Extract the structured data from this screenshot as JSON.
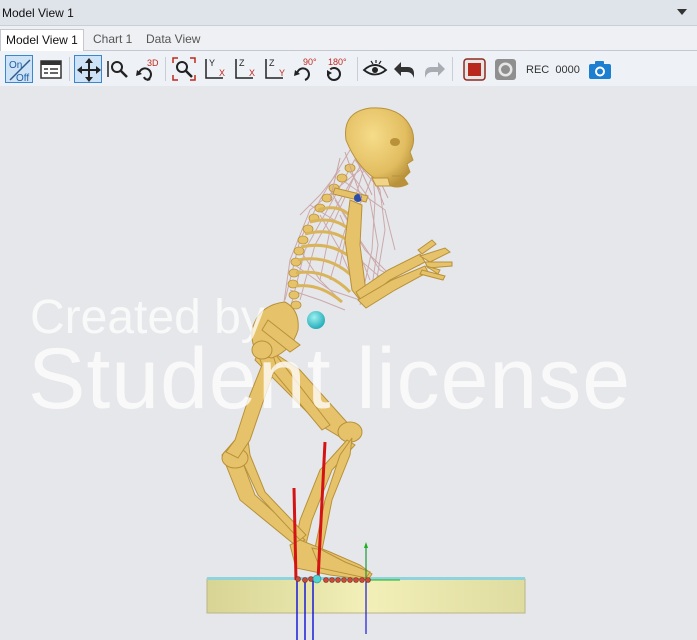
{
  "window": {
    "title": "Model View 1"
  },
  "tabs": [
    {
      "label": "Model View 1",
      "active": true
    },
    {
      "label": "Chart 1",
      "active": false
    },
    {
      "label": "Data View",
      "active": false
    }
  ],
  "toolbar": {
    "on_label": "On",
    "off_label": "Off",
    "label_3d": "3D",
    "axis_yx": [
      "Y",
      "X"
    ],
    "axis_zx": [
      "Z",
      "X"
    ],
    "axis_zy": [
      "Z",
      "Y"
    ],
    "rot_90": "90°",
    "rot_180": "180°",
    "rec_label": "REC",
    "rec_count": "0000",
    "icons": [
      "on-off-toggle-icon",
      "properties-icon",
      "pan-move-icon",
      "zoom-icon",
      "rotate-3d-icon",
      "zoom-fit-icon",
      "view-yx-icon",
      "view-zx-icon",
      "view-zy-icon",
      "rotate-90-icon",
      "rotate-180-icon",
      "visibility-eye-icon",
      "undo-icon",
      "redo-icon",
      "record-icon",
      "stop-icon",
      "camera-icon"
    ]
  },
  "viewport": {
    "watermark_line1": "Created by",
    "watermark_line2": "Student license"
  },
  "colors": {
    "bone": "#e6c36a",
    "bone_shadow": "#b8913a",
    "muscle": "#c9a3a5",
    "record_red": "#b8281d",
    "accent_blue": "#1c7fcf",
    "platform": "#e8e6a6",
    "force_red": "#d41414",
    "force_blue": "#1a1ad8",
    "axis_green": "#19b319"
  }
}
